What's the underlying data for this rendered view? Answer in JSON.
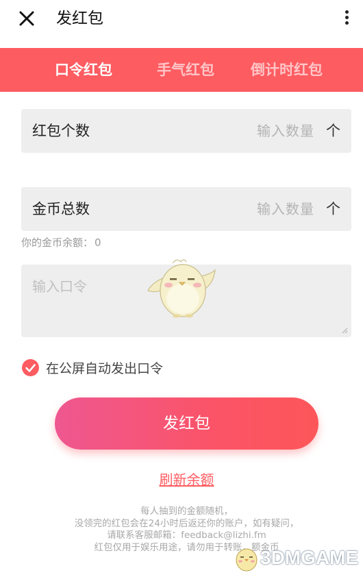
{
  "header": {
    "close_icon": "close-icon",
    "title": "发红包",
    "more_icon": "more-vertical-icon"
  },
  "tabs": [
    {
      "label": "口令红包",
      "active": true
    },
    {
      "label": "手气红包",
      "active": false
    },
    {
      "label": "倒计时红包",
      "active": false
    }
  ],
  "form": {
    "count": {
      "label": "红包个数",
      "placeholder": "输入数量",
      "unit": "个"
    },
    "coins": {
      "label": "金币总数",
      "placeholder": "输入数量",
      "unit": "个"
    },
    "balance_label": "你的金币余额：",
    "balance_value": "0",
    "password_placeholder": "输入口令",
    "auto_send_label": "在公屏自动发出口令",
    "auto_send_checked": true
  },
  "send_button": "发红包",
  "refresh_link": "刷新余额",
  "notes": [
    "每人抽到的金额随机，",
    "没领完的红包会在24小时后返还你的账户，如有疑问，",
    "请联系客服邮箱：feedback@lizhi.fm",
    "红包仅用于娱乐用途，请勿用于转账，额金币"
  ],
  "watermark": "3DMGAME",
  "colors": {
    "accent": "#fd5c61",
    "tab_inactive": "#ffc5c7",
    "field_bg": "#eeeeee",
    "button_gradient_start": "#ee5790",
    "button_gradient_end": "#fd5659"
  }
}
